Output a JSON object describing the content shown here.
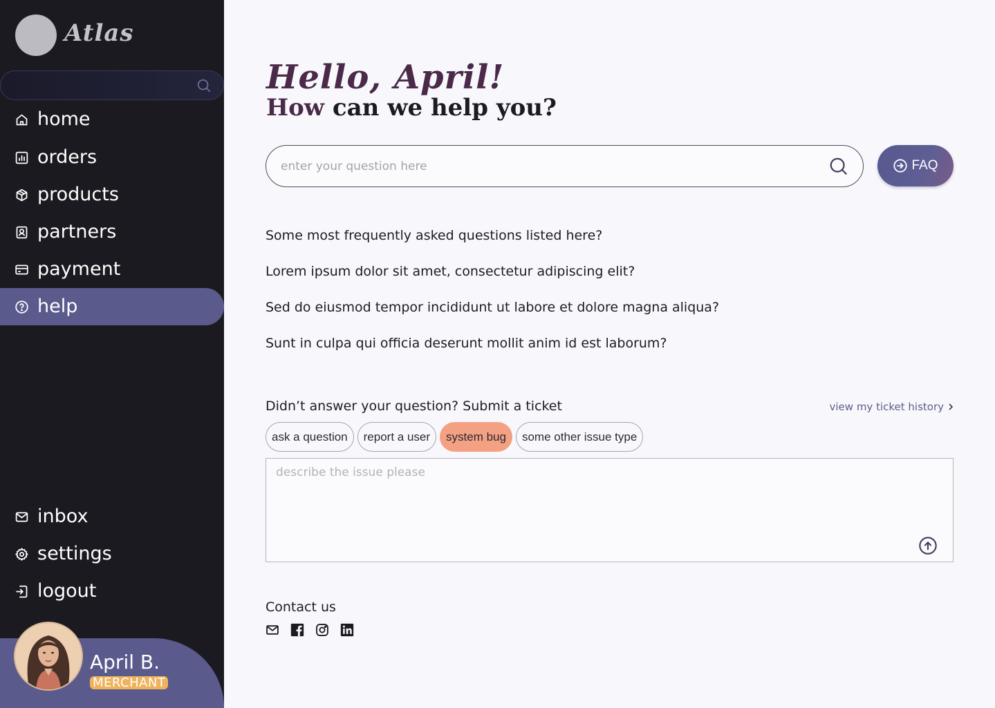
{
  "app": {
    "name": "Atlas"
  },
  "sidebar": {
    "search": {
      "placeholder": ""
    },
    "nav": [
      {
        "label": "home",
        "icon": "home-icon"
      },
      {
        "label": "orders",
        "icon": "chart-icon"
      },
      {
        "label": "products",
        "icon": "box-icon"
      },
      {
        "label": "partners",
        "icon": "contact-icon"
      },
      {
        "label": "payment",
        "icon": "card-icon"
      },
      {
        "label": "help",
        "icon": "help-icon",
        "active": true
      }
    ],
    "bottom_nav": [
      {
        "label": "inbox",
        "icon": "mail-icon"
      },
      {
        "label": "settings",
        "icon": "gear-icon"
      },
      {
        "label": "logout",
        "icon": "logout-icon"
      }
    ],
    "user": {
      "name": "April B.",
      "role": "MERCHANT"
    }
  },
  "main": {
    "greeting": {
      "hello": "Hello,",
      "name": "April!"
    },
    "subtitle": {
      "accent": "How",
      "rest": " can we help you?"
    },
    "search": {
      "placeholder": "enter your question here"
    },
    "faq_button": {
      "label": "FAQ"
    },
    "faqs": [
      "Some most frequently asked questions listed here?",
      "Lorem ipsum dolor sit amet, consectetur adipiscing elit?",
      "Sed do eiusmod tempor incididunt ut labore et dolore magna aliqua?",
      "Sunt in culpa qui officia deserunt mollit anim id est laborum?"
    ],
    "ticket": {
      "title": "Didn’t answer your question? Submit a ticket",
      "history_link": "view my ticket history",
      "types": [
        "ask a question",
        "report a user",
        "system bug",
        "some other issue type"
      ],
      "selected_type": "system bug",
      "placeholder": "describe the issue please"
    },
    "contact": {
      "title": "Contact us",
      "channels": [
        "mail-icon",
        "facebook-icon",
        "instagram-icon",
        "linkedin-icon"
      ]
    }
  },
  "colors": {
    "sidebar_bg": "#1b1a20",
    "accent": "#5a5b8c",
    "heading_accent": "#4b2a49",
    "chip_selected": "#f4a083",
    "role_badge": "#f0b25a"
  }
}
